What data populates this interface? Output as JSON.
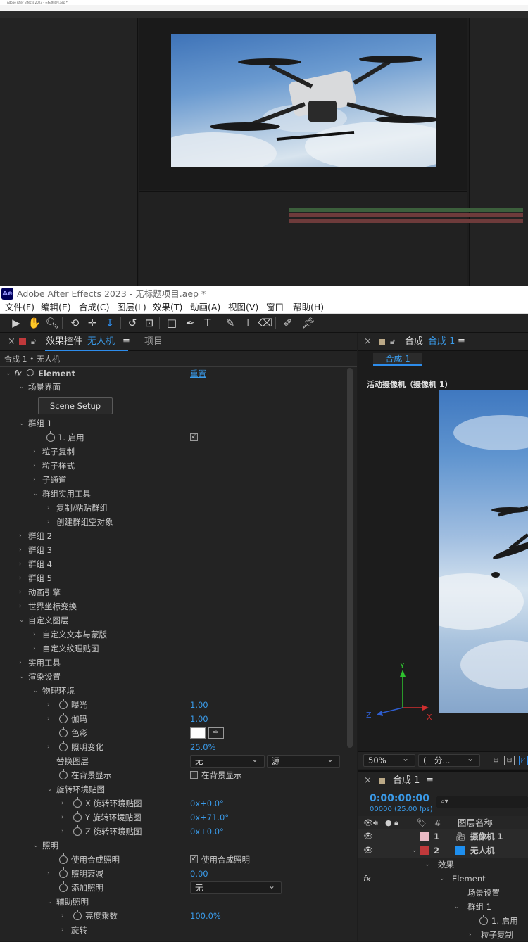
{
  "thumbnail": {
    "title": "Adobe After Effects 2023 - 无标题项目.aep *"
  },
  "window": {
    "logo": "Ae",
    "title": "Adobe After Effects 2023 - 无标题项目.aep *"
  },
  "menu": [
    "文件(F)",
    "编辑(E)",
    "合成(C)",
    "图层(L)",
    "效果(T)",
    "动画(A)",
    "视图(V)",
    "窗口",
    "帮助(H)"
  ],
  "effect_controls": {
    "tab_label": "效果控件",
    "layer": "无人机",
    "menu_glyph": "≡",
    "project_tab": "项目",
    "breadcrumb": "合成 1 • 无人机",
    "effect_name": "Element",
    "reset": "重置",
    "rows": {
      "scene_interface": "场景界面",
      "scene_setup": "Scene Setup",
      "group1": "群组 1",
      "enable": "1. 启用",
      "particle_replicate": "粒子复制",
      "particle_style": "粒子样式",
      "subchannel": "子通道",
      "group_util": "群组实用工具",
      "copy_paste": "复制/粘贴群组",
      "create_null": "创建群组空对象",
      "group2": "群组 2",
      "group3": "群组 3",
      "group4": "群组 4",
      "group5": "群组 5",
      "anim_engine": "动画引擎",
      "world_transform": "世界坐标变换",
      "custom_layers": "自定义图层",
      "custom_text_mask": "自定义文本与蒙版",
      "custom_texture": "自定义纹理贴图",
      "utilities": "实用工具",
      "render_settings": "渲染设置",
      "physical_env": "物理环境",
      "exposure": "曝光",
      "exposure_val": "1.00",
      "gamma": "伽玛",
      "gamma_val": "1.00",
      "tint": "色彩",
      "light_var": "照明变化",
      "light_var_val": "25.0%",
      "replace_layer": "替换图层",
      "replace_layer_val": "无",
      "replace_source_val": "源",
      "show_in_bg": "在背景显示",
      "show_in_bg_chk": "在背景显示",
      "rotate_env": "旋转环境贴图",
      "x_rot": "X 旋转环境贴图",
      "x_rot_val": "0x+0.0°",
      "y_rot": "Y 旋转环境贴图",
      "y_rot_val": "0x+71.0°",
      "z_rot": "Z 旋转环境贴图",
      "z_rot_val": "0x+0.0°",
      "lighting": "照明",
      "use_comp_light": "使用合成照明",
      "use_comp_light_chk": "使用合成照明",
      "light_falloff": "照明衰减",
      "light_falloff_val": "0.00",
      "add_light": "添加照明",
      "add_light_val": "无",
      "aux_light": "辅助照明",
      "brightness_mult": "亮度乘数",
      "brightness_mult_val": "100.0%",
      "rotation": "旋转"
    }
  },
  "composition": {
    "tab_label": "合成",
    "comp_name": "合成 1",
    "menu_glyph": "≡",
    "subtab": "合成 1",
    "camera_label": "活动摄像机（摄像机 1）",
    "zoom": "50%",
    "resolution": "(二分...",
    "axis": {
      "x": "X",
      "y": "Y",
      "z": "Z"
    }
  },
  "timeline": {
    "tab_label": "合成 1",
    "menu_glyph": "≡",
    "timecode": "0:00:00:00",
    "frame_info": "00000 (25.00 fps)",
    "search_glyph": "⌕▾",
    "col_hash": "#",
    "col_layer_name": "图层名称",
    "layers": [
      {
        "num": "1",
        "name": "摄像机 1",
        "color": "#e9b9c4"
      },
      {
        "num": "2",
        "name": "无人机",
        "color": "#c0393b",
        "icon_color": "#1e8fef"
      }
    ],
    "tree": {
      "effects": "效果",
      "fx": "fx",
      "element": "Element",
      "scene": "场景设置",
      "group1": "群组 1",
      "enable": "1. 启用",
      "particle_rep": "粒子复制"
    }
  },
  "colors": {
    "accent": "#2d8ceb",
    "panel": "#232323",
    "text": "#c8c8c8"
  }
}
